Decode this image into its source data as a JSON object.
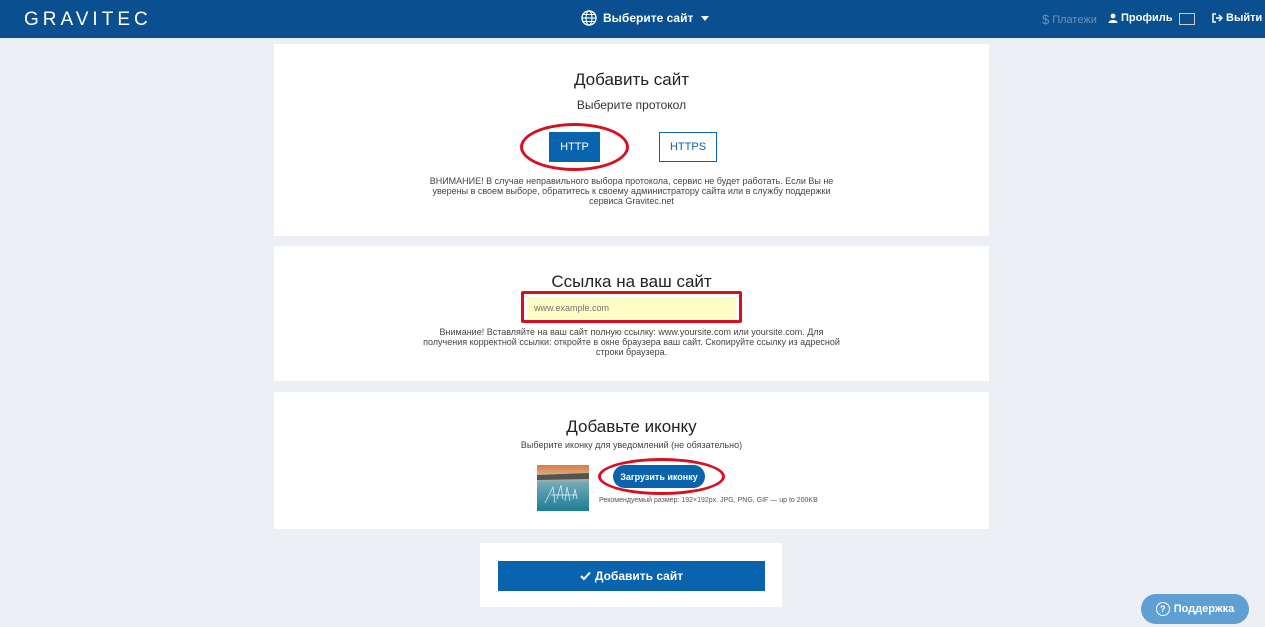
{
  "nav": {
    "logo": "GRAVITEC",
    "site_select": "Выберите сайт",
    "payments": "Платежи",
    "profile": "Профиль",
    "exit": "Выйти",
    "language_flag": "ru"
  },
  "protocol_section": {
    "title": "Добавить сайт",
    "subtitle": "Выберите протокол",
    "http_label": "HTTP",
    "https_label": "HTTPS",
    "warning_line1": "ВНИМАНИЕ! В случае неправильного выбора протокола, сервис не будет работать. Если Вы не",
    "warning_line2": "уверены в своем выборе, обратитесь к своему администратору сайта или в службу поддержки",
    "warning_line3": "сервиса Gravitec.net"
  },
  "url_section": {
    "title": "Ссылка на ваш сайт",
    "input_value": "",
    "input_placeholder": "www.example.com",
    "note_line1": "Внимание! Вставляйте на ваш сайт полную ссылку: www.yoursite.com или yoursite.com. Для",
    "note_line2": "получения корректной ссылки: откройте в окне браузера ваш сайт. Скопируйте ссылку из адресной",
    "note_line3": "строки браузера."
  },
  "icon_section": {
    "title": "Добавьте иконку",
    "subtitle": "Выберите иконку для уведомлений (не обязательно)",
    "upload_label": "Загрузить иконку",
    "hint": "Рекомендуемый размер: 192×192px. JPG, PNG, GIF — up to 200KB"
  },
  "submit": {
    "label": "Добавить сайт"
  },
  "support": {
    "label": "Поддержка"
  },
  "colors": {
    "navbar": "#0a4f8f",
    "accent": "#0a64ad",
    "highlight_ring": "#d80f1f",
    "input_bg": "#fdfdc5",
    "support": "#5f9fd3"
  },
  "icons": [
    "globe-icon",
    "caret-down-icon",
    "dollar-icon",
    "user-icon",
    "flag-icon",
    "exit-icon",
    "check-icon",
    "question-icon"
  ]
}
